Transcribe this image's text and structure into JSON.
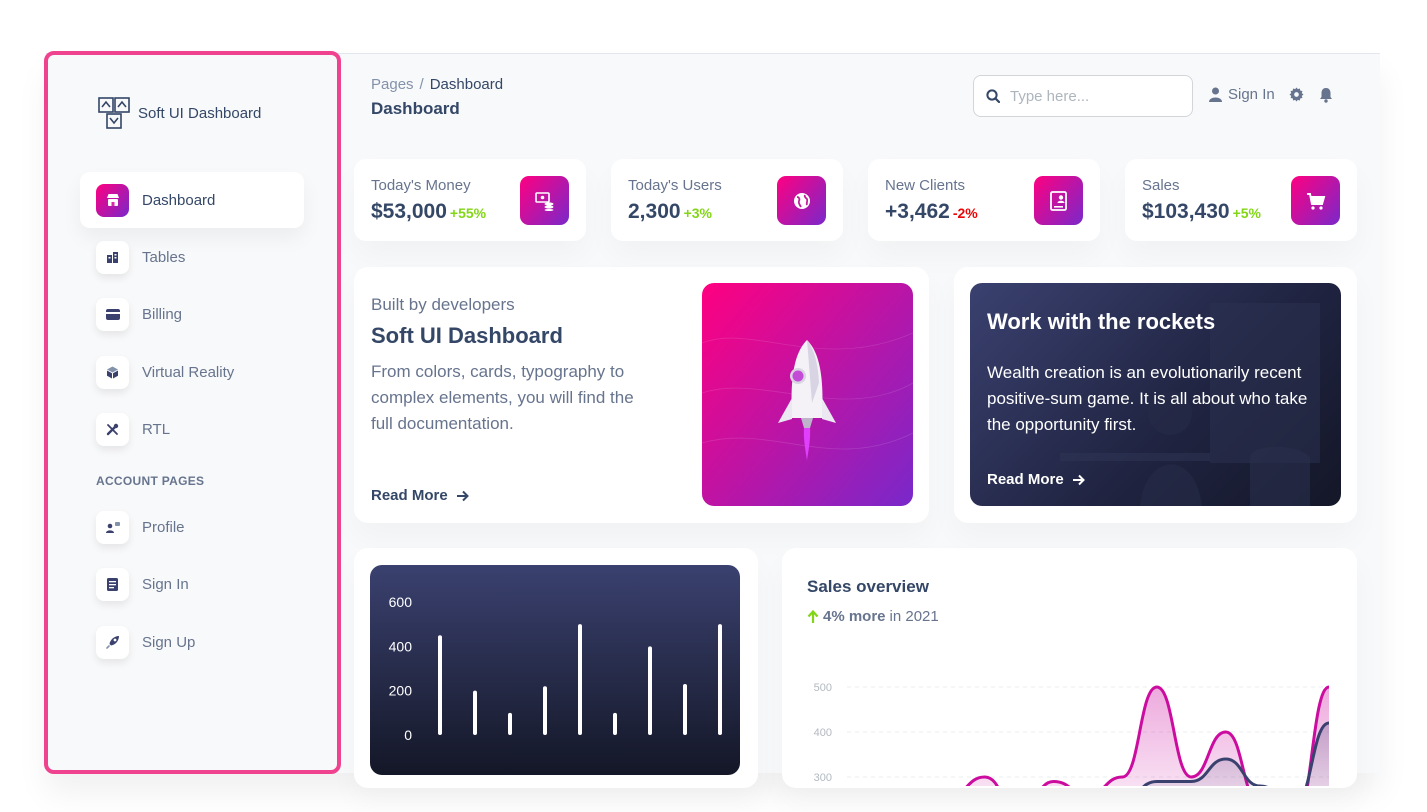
{
  "brand": {
    "name": "Soft UI Dashboard"
  },
  "sidebar": {
    "items": [
      {
        "label": "Dashboard",
        "icon": "shop-icon",
        "active": true
      },
      {
        "label": "Tables",
        "icon": "office-icon"
      },
      {
        "label": "Billing",
        "icon": "credit-card-icon"
      },
      {
        "label": "Virtual Reality",
        "icon": "box-3d-icon"
      },
      {
        "label": "RTL",
        "icon": "settings-tools-icon"
      }
    ],
    "section_label": "ACCOUNT PAGES",
    "account_items": [
      {
        "label": "Profile",
        "icon": "customer-support-icon"
      },
      {
        "label": "Sign In",
        "icon": "document-icon"
      },
      {
        "label": "Sign Up",
        "icon": "spaceship-icon"
      }
    ]
  },
  "header": {
    "breadcrumb_root": "Pages",
    "breadcrumb_sep": "/",
    "breadcrumb_current": "Dashboard",
    "title": "Dashboard",
    "search_placeholder": "Type here...",
    "signin_label": "Sign In"
  },
  "stats": [
    {
      "label": "Today's Money",
      "value": "$53,000",
      "change": "+55%",
      "trend": "up",
      "icon": "money-icon"
    },
    {
      "label": "Today's Users",
      "value": "2,300",
      "change": "+3%",
      "trend": "up",
      "icon": "globe-icon"
    },
    {
      "label": "New Clients",
      "value": "+3,462",
      "change": "-2%",
      "trend": "down",
      "icon": "document-user-icon"
    },
    {
      "label": "Sales",
      "value": "$103,430",
      "change": "+5%",
      "trend": "up",
      "icon": "cart-icon"
    }
  ],
  "built_card": {
    "kicker": "Built by developers",
    "heading": "Soft UI Dashboard",
    "description": "From colors, cards, typography to complex elements, you will find the full documentation.",
    "link": "Read More"
  },
  "rockets_card": {
    "heading": "Work with the rockets",
    "description": "Wealth creation is an evolutionarily recent positive-sum game. It is all about who take the opportunity first.",
    "link": "Read More"
  },
  "sales_overview": {
    "title": "Sales overview",
    "change": "4% more",
    "period": "in 2021"
  },
  "chart_data": [
    {
      "type": "bar",
      "ytick_labels": [
        "600",
        "400",
        "200",
        "0"
      ],
      "yticks": [
        600,
        400,
        200,
        0
      ],
      "ylim": [
        0,
        600
      ],
      "values": [
        450,
        200,
        100,
        220,
        500,
        100,
        400,
        230,
        500
      ],
      "color": "#ffffff"
    },
    {
      "type": "area",
      "title": "Sales overview",
      "ytick_labels": [
        "500",
        "400",
        "300"
      ],
      "yticks": [
        500,
        400,
        300
      ],
      "ylim": [
        250,
        520
      ],
      "series": [
        {
          "values": [
            220,
            250,
            240,
            260,
            300,
            220,
            290,
            260,
            300,
            500,
            300,
            400,
            240,
            200,
            500
          ],
          "color": "#cb0c9f"
        },
        {
          "values": [
            200,
            230,
            220,
            240,
            260,
            250,
            230,
            240,
            250,
            290,
            290,
            340,
            280,
            240,
            420
          ],
          "color": "#3a416f"
        }
      ]
    }
  ],
  "colors": {
    "accent_from": "#7928ca",
    "accent_to": "#ff0080",
    "dark": "#344767",
    "muted": "#67748e",
    "positive": "#82d616",
    "negative": "#ea0606"
  }
}
